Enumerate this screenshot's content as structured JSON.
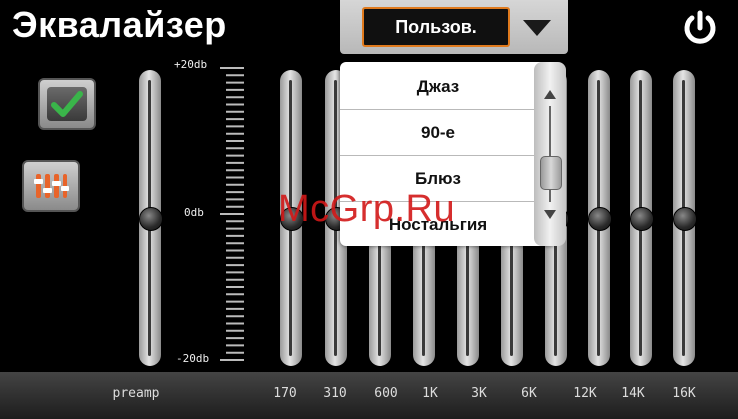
{
  "header": {
    "title": "Эквалайзер",
    "preset_selected": "Пользов.",
    "power_icon": "power-icon"
  },
  "side_buttons": {
    "confirm_icon": "checkmark-icon",
    "settings_icon": "equalizer-sliders-icon"
  },
  "scale": {
    "top_label": "+20db",
    "mid_label": "0db",
    "bottom_label": "-20db"
  },
  "bands": [
    {
      "label": "preamp",
      "level_db": 0
    },
    {
      "label": "170",
      "level_db": 0
    },
    {
      "label": "310",
      "level_db": 0
    },
    {
      "label": "600",
      "level_db": 0
    },
    {
      "label": "1K",
      "level_db": 0
    },
    {
      "label": "3K",
      "level_db": 0
    },
    {
      "label": "6K",
      "level_db": 0
    },
    {
      "label": "12K",
      "level_db": 0
    },
    {
      "label": "14K",
      "level_db": 0
    },
    {
      "label": "16K",
      "level_db": 0
    }
  ],
  "preset_list": {
    "items": [
      "Джаз",
      "90-е",
      "Блюз",
      "Ностальгия"
    ]
  },
  "watermark": "McGrp.Ru",
  "colors": {
    "accent": "#e07a1d",
    "check": "#3ab54a",
    "eq_icon": "#e8642a",
    "watermark": "#d21818"
  }
}
